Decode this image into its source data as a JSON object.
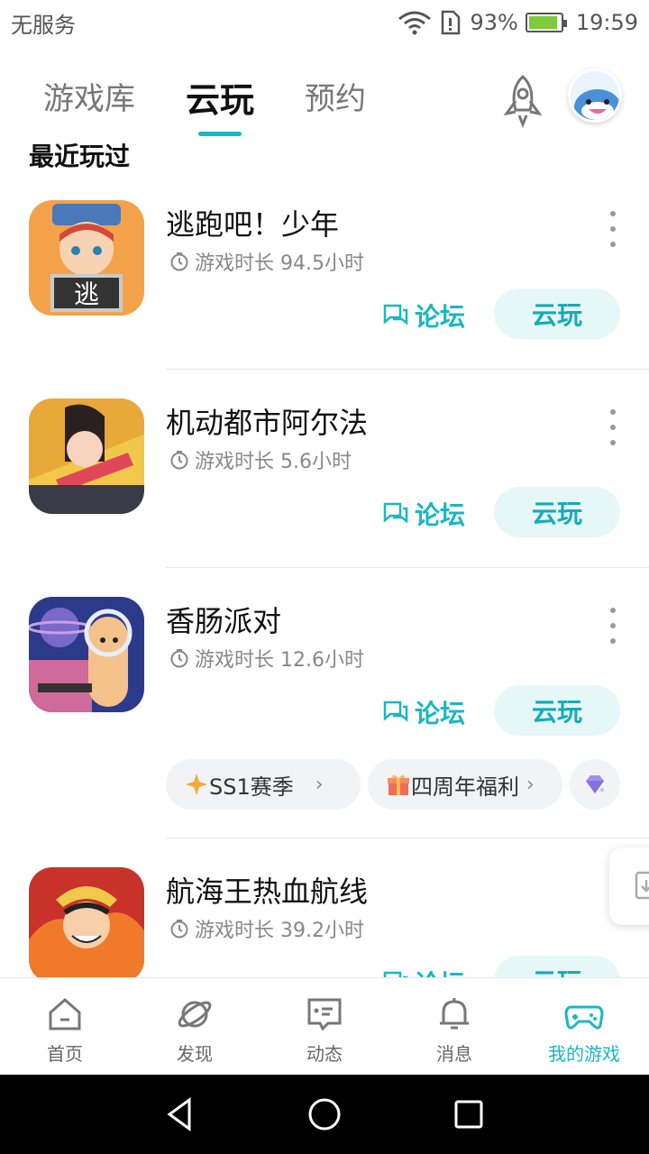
{
  "status_bar": {
    "carrier": "无服务",
    "battery": "93%",
    "battery_level": 0.93,
    "time": "19:59"
  },
  "top_tabs": [
    {
      "label": "游戏库",
      "active": false
    },
    {
      "label": "云玩",
      "active": true
    },
    {
      "label": "预约",
      "active": false
    }
  ],
  "section_title": "最近玩过",
  "games": [
    {
      "name": "逃跑吧！少年",
      "play_time": "游戏时长 94.5小时",
      "icon": "escape-game-icon",
      "forum_label": "论坛",
      "cloud_label": "云玩"
    },
    {
      "name": "机动都市阿尔法",
      "play_time": "游戏时长 5.6小时",
      "icon": "alpha-city-game-icon",
      "forum_label": "论坛",
      "cloud_label": "云玩"
    },
    {
      "name": "香肠派对",
      "play_time": "游戏时长 12.6小时",
      "icon": "sausage-party-game-icon",
      "forum_label": "论坛",
      "cloud_label": "云玩",
      "chips": [
        {
          "label": "SS1赛季",
          "icon": "sparkle-icon"
        },
        {
          "label": "四周年福利",
          "icon": "gift-icon"
        },
        {
          "label": "",
          "icon": "diamond-icon"
        }
      ]
    },
    {
      "name": "航海王热血航线",
      "play_time": "游戏时长 39.2小时",
      "icon": "one-piece-game-icon",
      "forum_label": "论坛",
      "cloud_label": "云玩"
    }
  ],
  "bottom_nav": [
    {
      "label": "首页",
      "icon": "home-icon",
      "active": false
    },
    {
      "label": "发现",
      "icon": "planet-icon",
      "active": false
    },
    {
      "label": "动态",
      "icon": "message-icon",
      "active": false
    },
    {
      "label": "消息",
      "icon": "bell-icon",
      "active": false
    },
    {
      "label": "我的游戏",
      "icon": "gamepad-icon",
      "active": true
    }
  ],
  "colors": {
    "accent": "#19b7c4",
    "cloud_button_bg": "#e6f7f8",
    "chip_bg": "#f2f3f5",
    "battery_fill": "#7ecb3c"
  }
}
